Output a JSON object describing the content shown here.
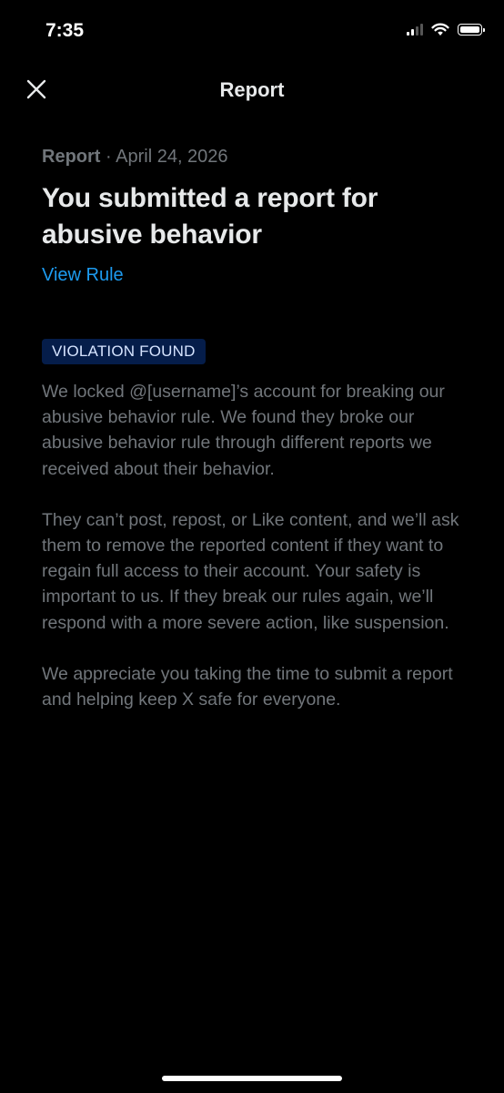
{
  "status_bar": {
    "time": "7:35",
    "icons": [
      "cellular-signal-icon",
      "wifi-icon",
      "battery-icon"
    ]
  },
  "header": {
    "title": "Report",
    "close_icon": "close-icon"
  },
  "report": {
    "meta_label": "Report",
    "meta_separator": " · ",
    "date": "April 24, 2026",
    "headline": "You submitted a report for abusive behavior",
    "view_rule_link": "View Rule",
    "badge": "VIOLATION FOUND",
    "paragraphs": [
      "We locked @[username]’s account for breaking our abusive behavior rule. We found they broke our abusive behavior rule through different reports we received about their behavior.",
      "They can’t post, repost, or Like content, and we’ll ask them to remove the reported content if they want to regain full access to their account. Your safety is important to us. If they break our rules again, we’ll respond with a more severe action, like suspension.",
      "We appreciate you taking the time to submit a report and helping keep X safe for everyone."
    ]
  },
  "colors": {
    "background": "#000000",
    "primary_text": "#e7e9ea",
    "secondary_text": "#71767b",
    "link": "#1d9bf0",
    "badge_background": "#051d4a",
    "badge_text": "#d6e4ff"
  }
}
